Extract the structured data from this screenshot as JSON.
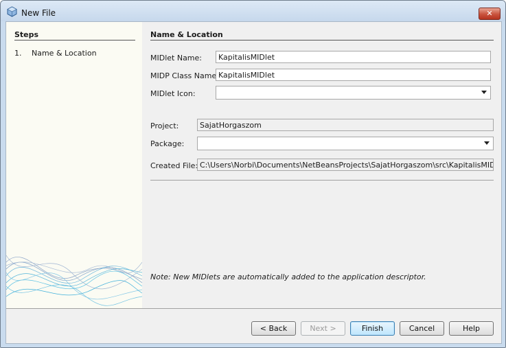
{
  "window": {
    "title": "New File",
    "close_glyph": "✕"
  },
  "steps": {
    "title": "Steps",
    "items": [
      {
        "num": "1.",
        "label": "Name & Location"
      }
    ]
  },
  "section": {
    "title": "Name & Location"
  },
  "form": {
    "midlet_name": {
      "label": "MIDlet Name:",
      "value": "KapitalisMIDlet"
    },
    "midp_class_name": {
      "label": "MIDP Class Name:",
      "value": "KapitalisMIDlet"
    },
    "midlet_icon": {
      "label": "MIDlet Icon:",
      "value": ""
    },
    "project": {
      "label": "Project:",
      "value": "SajatHorgaszom"
    },
    "package": {
      "label": "Package:",
      "value": ""
    },
    "created_file": {
      "label": "Created File:",
      "value": "C:\\Users\\Norbi\\Documents\\NetBeansProjects\\SajatHorgaszom\\src\\KapitalisMIDlet.java"
    }
  },
  "note": "Note: New MIDlets are automatically added to the application descriptor.",
  "buttons": {
    "back": "< Back",
    "next": "Next >",
    "finish": "Finish",
    "cancel": "Cancel",
    "help": "Help"
  },
  "icons": {
    "app": "netbeans-cube-icon",
    "close": "close-icon",
    "dropdown": "chevron-down-icon"
  },
  "colors": {
    "titlebar": "#c6d8ec",
    "steps_bg": "#fbfbf3",
    "close": "#c9533e",
    "wave": "#4fb3d9"
  }
}
